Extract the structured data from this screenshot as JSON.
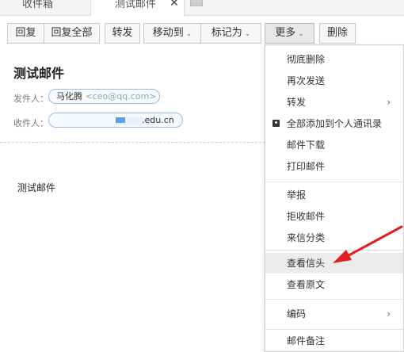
{
  "tabs": [
    {
      "label": "收件箱"
    },
    {
      "label": "测试邮件",
      "close": "✕"
    }
  ],
  "toolbar": {
    "reply": "回复",
    "reply_all": "回复全部",
    "forward": "转发",
    "move_to": "移动到",
    "mark_as": "标记为",
    "more": "更多",
    "delete": "删除",
    "caret": "⌄"
  },
  "message": {
    "subject": "测试邮件",
    "from_label": "发件人：",
    "from_name": "马化腾",
    "from_email": "<ceo@qq.com>",
    "to_label": "收件人：",
    "to_text": ".edu.cn",
    "body": "测试邮件"
  },
  "menu": {
    "items": [
      {
        "label": "彻底删除"
      },
      {
        "label": "再次发送"
      },
      {
        "label": "转发",
        "submenu": "›"
      },
      {
        "label": "全部添加到个人通讯录"
      },
      {
        "label": "邮件下载"
      },
      {
        "label": "打印邮件"
      },
      {
        "label": "举报"
      },
      {
        "label": "拒收邮件"
      },
      {
        "label": "来信分类"
      },
      {
        "label": "查看信头"
      },
      {
        "label": "查看原文"
      },
      {
        "label": "编码",
        "submenu": "›"
      },
      {
        "label": "邮件备注"
      }
    ]
  },
  "colors": {
    "accent_arrow": "#e02020",
    "chip_border": "#99bbdd"
  }
}
